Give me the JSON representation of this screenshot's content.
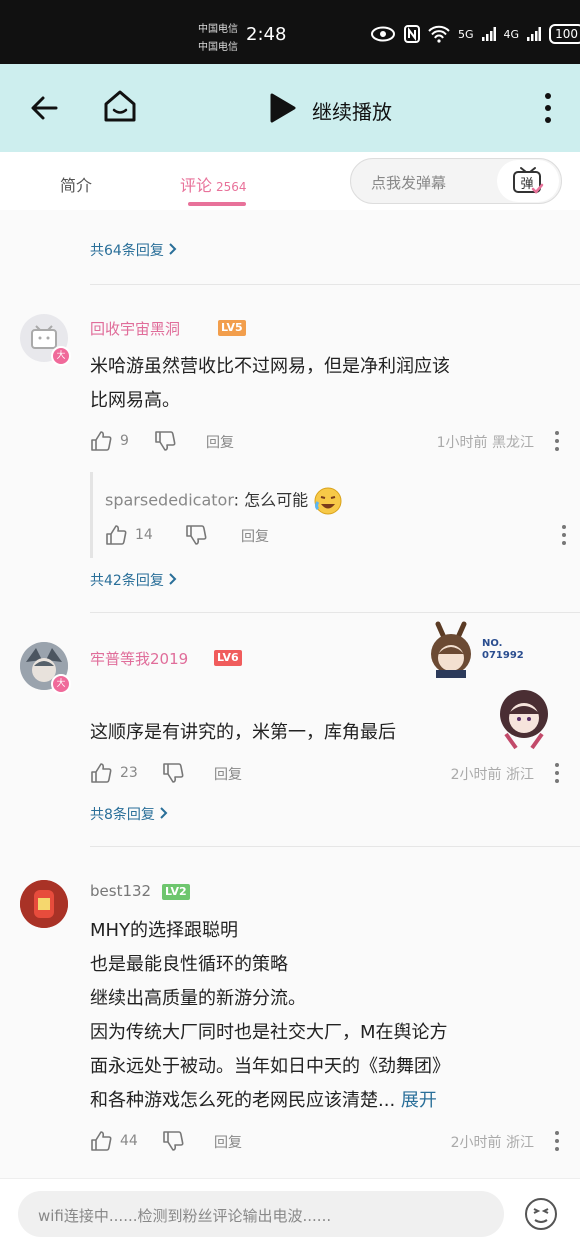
{
  "status_bar": {
    "carrier1": "中国电信",
    "carrier2": "中国电信",
    "time": "2:48",
    "net1": "5G",
    "net2": "4G",
    "battery": "100"
  },
  "app_bar": {
    "continue_play": "继续播放"
  },
  "tabs": [
    {
      "label": "简介"
    },
    {
      "label": "评论",
      "count": "2564"
    }
  ],
  "danmaku": {
    "placeholder": "点我发弹幕",
    "button": "弹"
  },
  "comments": [
    {
      "more_replies": "共64条回复"
    },
    {
      "user": "回收宇宙黑洞",
      "level": "LV5",
      "badge": "大",
      "text_lines": [
        "米哈游虽然营收比不过网易，但是净利润应该",
        "比网易高。"
      ],
      "likes": "9",
      "reply_label": "回复",
      "meta": "1小时前  黑龙江",
      "subreply": {
        "user": "sparsededicator",
        "sep": ": ",
        "text": "怎么可能",
        "likes": "14",
        "reply_label": "回复"
      },
      "more_replies": "共42条回复"
    },
    {
      "user": "牢普等我2019",
      "level": "LV6",
      "badge": "大",
      "medal_no_1": "NO.",
      "medal_no_2": "071992",
      "text_lines": [
        "这顺序是有讲究的，米第一，库角最后"
      ],
      "likes": "23",
      "reply_label": "回复",
      "meta": "2小时前  浙江",
      "more_replies": "共8条回复"
    },
    {
      "user": "best132",
      "level": "LV2",
      "text_lines": [
        "MHY的选择跟聪明",
        "也是最能良性循环的策略",
        "继续出高质量的新游分流。",
        "因为传统大厂同时也是社交大厂，M在舆论方",
        "面永远处于被动。当年如日中天的《劲舞团》",
        "和各种游戏怎么死的老网民应该清楚..."
      ],
      "expand": "展开",
      "likes": "44",
      "reply_label": "回复",
      "meta": "2小时前  浙江"
    }
  ],
  "input_bar": {
    "placeholder": "wifi连接中......检测到粉丝评论输出电波......"
  },
  "colors": {
    "accent_pink": "#e8729a",
    "link_blue": "#2a6f99",
    "header_bg": "#cdeeee"
  }
}
